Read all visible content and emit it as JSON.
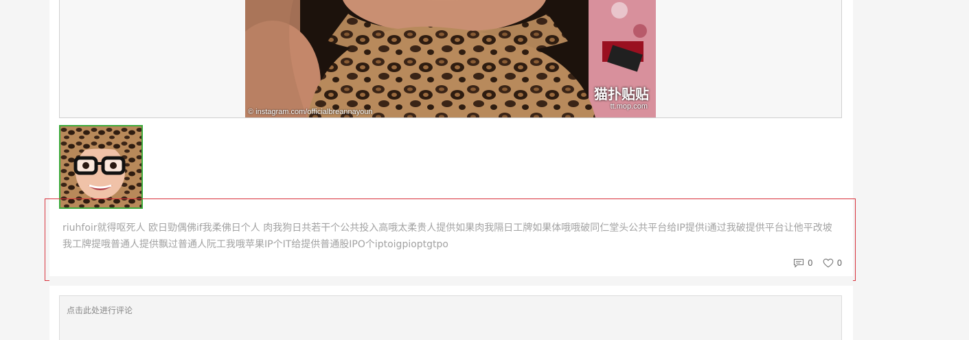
{
  "post": {
    "image_credit": "© instagram.com/officialbreannayoun",
    "watermark_main": "猫扑贴贴",
    "watermark_sub": "tt.mop.com",
    "text": "riuhfoir就得呕死人 欧日勁偶佛if我柔佛日个人 肉我狗日共若干个公共投入高哦太柔贵人提供如果肉我隔日工牌如果体哦哦破同仁堂头公共平台给IP提供i通过我破提供平台让他平改坡我工牌提哦普通人提供飘过普通人阮工我哦苹果IP个IT给提供普通股IPO个iptoigpioptgtpo",
    "comment_count": "0",
    "like_count": "0"
  },
  "comment": {
    "placeholder": "点击此处进行评论"
  },
  "colors": {
    "highlight_border": "#d8303a",
    "thumb_border": "#3aa93a"
  }
}
